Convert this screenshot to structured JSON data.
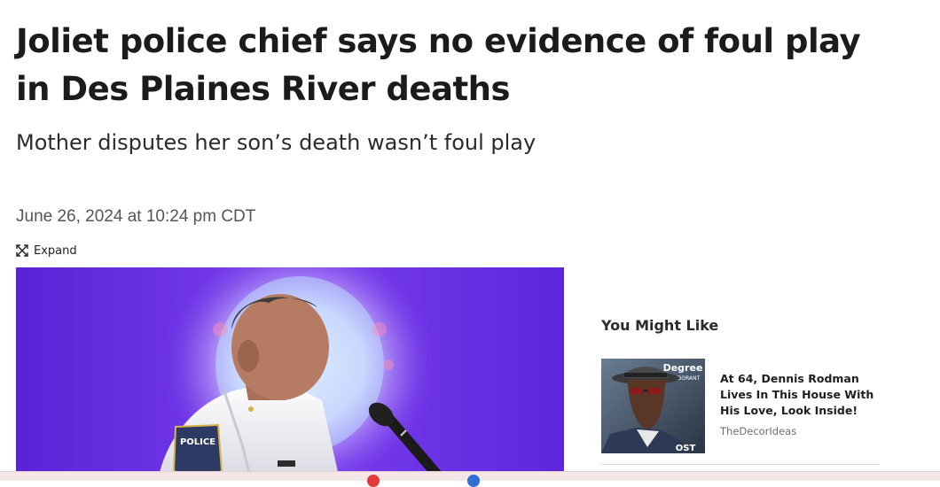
{
  "article": {
    "headline": "Joliet police chief says no evidence of foul play in Des Plaines River deaths",
    "subheadline": "Mother disputes her son’s death wasn’t foul play",
    "dateline": "June 26, 2024 at 10:24 pm CDT",
    "expand_label": "Expand",
    "hero_image": {
      "icon": "photo",
      "badge_text": "POLICE"
    }
  },
  "sidebar": {
    "title": "You Might Like",
    "cards": [
      {
        "title": "At 64, Dennis Rodman Lives In This House With His Love, Look Inside!",
        "source": "TheDecorIdeas",
        "thumb_text": [
          "Degree",
          "DEODORANT",
          "OST"
        ]
      }
    ]
  },
  "colors": {
    "hero_purple": "#6a2be0",
    "hero_glow": "#f4f0ff",
    "uniform_white": "#f2f2f2",
    "bottom_bar": "#f4e6e6"
  }
}
